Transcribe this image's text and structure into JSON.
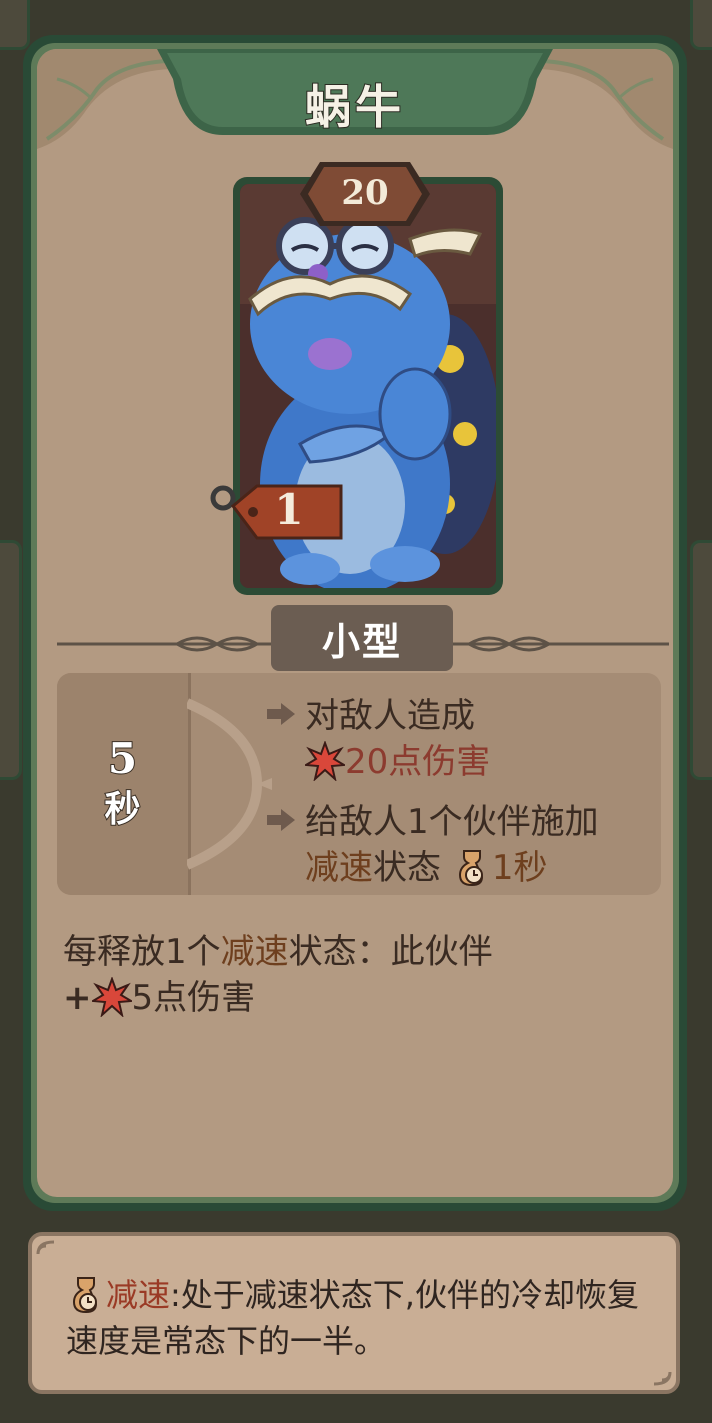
{
  "title": "蜗牛",
  "cost": "20",
  "tier": "1",
  "size_label": "小型",
  "cooldown": {
    "value": "5",
    "unit": "秒"
  },
  "effects": [
    {
      "line1": "对敌人造成",
      "damage": "20点伤害"
    },
    {
      "line1": "给敌人1个伙伴施加",
      "status": "减速",
      "status_suffix": "状态",
      "duration": "1秒"
    }
  ],
  "passive": {
    "prefix": "每释放1个",
    "status": "减速",
    "suffix": "状态：此伙伴",
    "plus": "+",
    "damage": "5点伤害"
  },
  "tooltip": {
    "keyword": "减速",
    "text": ":处于减速状态下,伙伴的冷却恢复速度是常态下的一半。"
  },
  "icons": {
    "damage": "explosion-icon",
    "slow": "hourglass-clock-icon",
    "bullet": "arrow-bullet-icon"
  },
  "colors": {
    "panel_bg": "#b39a82",
    "frame": "#294a36",
    "damage": "#8c3b2f",
    "slow": "#6e3f1e"
  }
}
